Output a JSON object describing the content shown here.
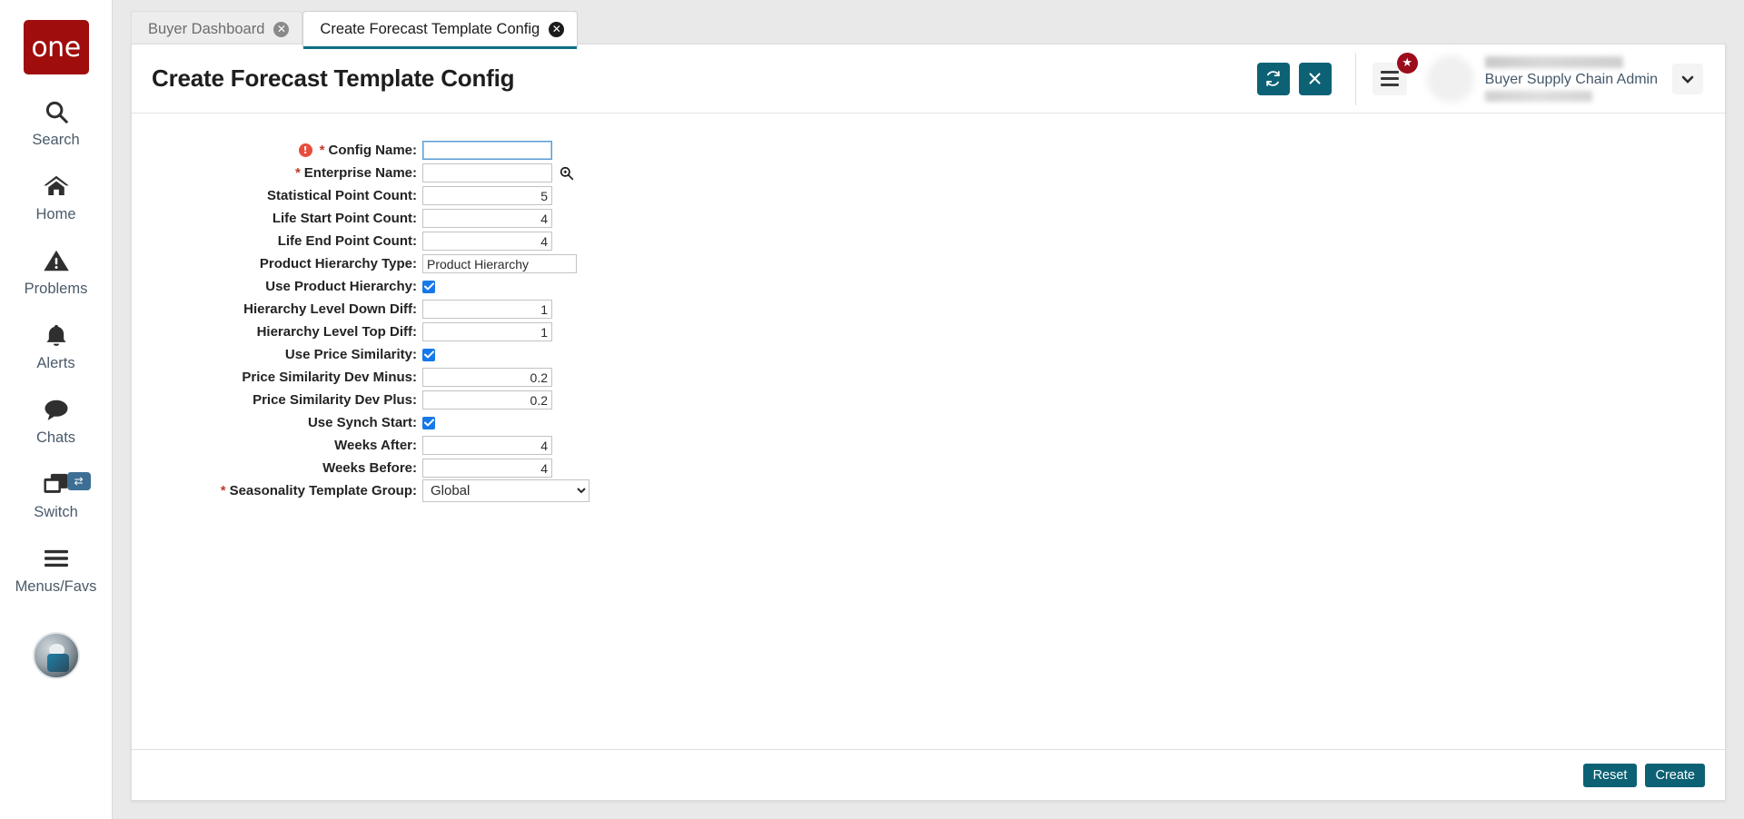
{
  "sidebar": {
    "logo_text": "one",
    "items": [
      {
        "label": "Search",
        "icon": "search-icon"
      },
      {
        "label": "Home",
        "icon": "home-icon"
      },
      {
        "label": "Problems",
        "icon": "warning-triangle-icon"
      },
      {
        "label": "Alerts",
        "icon": "bell-icon"
      },
      {
        "label": "Chats",
        "icon": "chat-bubble-icon"
      },
      {
        "label": "Switch",
        "icon": "windows-stack-icon",
        "badge_icon": "swap-arrows-icon"
      },
      {
        "label": "Menus/Favs",
        "icon": "hamburger-icon"
      }
    ],
    "avatar_icon": "user-avatar-icon"
  },
  "tabs": [
    {
      "label": "Buyer Dashboard",
      "active": false,
      "close_icon": "close-circle-icon"
    },
    {
      "label": "Create Forecast Template Config",
      "active": true,
      "close_icon": "close-circle-icon"
    }
  ],
  "header": {
    "title": "Create Forecast Template Config",
    "refresh_icon": "refresh-icon",
    "close_icon": "x-icon",
    "menu_icon": "hamburger-menu-icon",
    "star_badge_icon": "star-icon",
    "user_role": "Buyer Supply Chain Admin",
    "caret_icon": "chevron-down-icon"
  },
  "form": {
    "fields": [
      {
        "label": "Config Name:",
        "required": true,
        "error": true,
        "type": "text",
        "value": "",
        "focused": true,
        "name": "config-name"
      },
      {
        "label": "Enterprise Name:",
        "required": true,
        "error": false,
        "type": "text-search",
        "value": "",
        "focused": false,
        "name": "enterprise-name",
        "search_icon": "magnifier-icon"
      },
      {
        "label": "Statistical Point Count:",
        "required": false,
        "error": false,
        "type": "number",
        "value": "5",
        "name": "statistical-point-count"
      },
      {
        "label": "Life Start Point Count:",
        "required": false,
        "error": false,
        "type": "number",
        "value": "4",
        "name": "life-start-point-count"
      },
      {
        "label": "Life End Point Count:",
        "required": false,
        "error": false,
        "type": "number",
        "value": "4",
        "name": "life-end-point-count"
      },
      {
        "label": "Product Hierarchy Type:",
        "required": false,
        "error": false,
        "type": "text-left",
        "value": "Product Hierarchy",
        "name": "product-hierarchy-type"
      },
      {
        "label": "Use Product Hierarchy:",
        "required": false,
        "error": false,
        "type": "checkbox",
        "checked": true,
        "name": "use-product-hierarchy"
      },
      {
        "label": "Hierarchy Level Down Diff:",
        "required": false,
        "error": false,
        "type": "number",
        "value": "1",
        "name": "hierarchy-level-down-diff"
      },
      {
        "label": "Hierarchy Level Top Diff:",
        "required": false,
        "error": false,
        "type": "number",
        "value": "1",
        "name": "hierarchy-level-top-diff"
      },
      {
        "label": "Use Price Similarity:",
        "required": false,
        "error": false,
        "type": "checkbox",
        "checked": true,
        "name": "use-price-similarity"
      },
      {
        "label": "Price Similarity Dev Minus:",
        "required": false,
        "error": false,
        "type": "number",
        "value": "0.2",
        "name": "price-similarity-dev-minus"
      },
      {
        "label": "Price Similarity Dev Plus:",
        "required": false,
        "error": false,
        "type": "number",
        "value": "0.2",
        "name": "price-similarity-dev-plus"
      },
      {
        "label": "Use Synch Start:",
        "required": false,
        "error": false,
        "type": "checkbox",
        "checked": true,
        "name": "use-synch-start"
      },
      {
        "label": "Weeks After:",
        "required": false,
        "error": false,
        "type": "number",
        "value": "4",
        "name": "weeks-after"
      },
      {
        "label": "Weeks Before:",
        "required": false,
        "error": false,
        "type": "number",
        "value": "4",
        "name": "weeks-before"
      },
      {
        "label": "Seasonality Template Group:",
        "required": true,
        "error": false,
        "type": "select",
        "value": "Global",
        "options": [
          "Global"
        ],
        "name": "seasonality-template-group"
      }
    ]
  },
  "footer": {
    "reset_label": "Reset",
    "create_label": "Create"
  },
  "colors": {
    "accent": "#0d6174",
    "logo_red": "#a00d0d",
    "checkbox_blue": "#1778e8",
    "error_red": "#e74c3c",
    "badge_red": "#9c0c1c"
  }
}
